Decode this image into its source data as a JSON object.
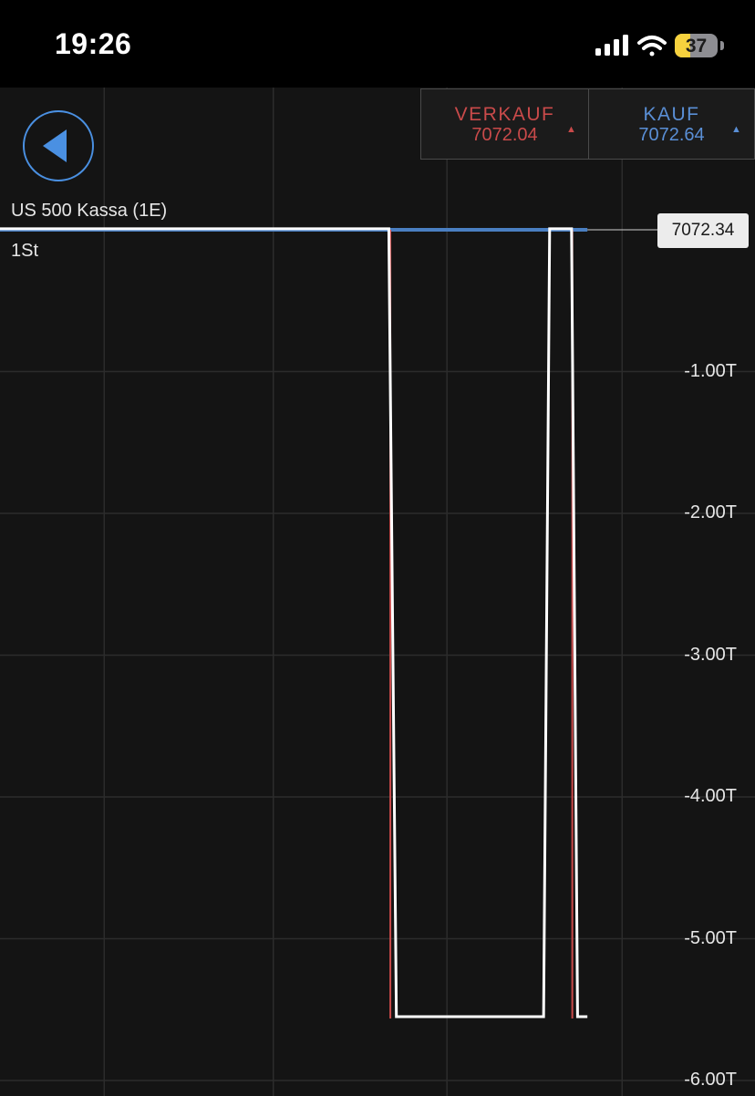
{
  "status_bar": {
    "time": "19:26",
    "battery_percent": "37",
    "battery_level": 0.37,
    "icons": [
      "signal-bars-icon",
      "wifi-icon",
      "battery-icon"
    ]
  },
  "header": {
    "back_icon": "back-arrow-icon",
    "instrument": "US 500 Kassa (1E)",
    "timeframe": "1St"
  },
  "quotes": {
    "sell_label": "VERKAUF",
    "sell_price": "7072.04",
    "sell_direction": "up",
    "buy_label": "KAUF",
    "buy_price": "7072.64",
    "buy_direction": "up"
  },
  "colors": {
    "background": "#141414",
    "sell": "#c94a4a",
    "buy": "#5a8fd6",
    "price_line": "#ffffff",
    "last_price_line": "#4a7fc1",
    "gridline": "#2c2c2c"
  },
  "chart_data": {
    "type": "line",
    "last_price": "7072.34",
    "y_ticks": [
      "-1.00T",
      "-2.00T",
      "-3.00T",
      "-4.00T",
      "-5.00T",
      "-6.00T"
    ],
    "y_tick_values": [
      -1000,
      -2000,
      -3000,
      -4000,
      -5000,
      -6000
    ],
    "ylim": [
      -6000,
      7.07234
    ],
    "series": [
      {
        "values": [
          7.07234,
          7.07234,
          -5550,
          -5550,
          7.07234,
          7.07234,
          -5550,
          -5550
        ],
        "x": [
          0,
          0.515,
          0.525,
          0.72,
          0.728,
          0.757,
          0.765,
          0.778
        ]
      }
    ],
    "sell_spikes_x": [
      0.517,
      0.758
    ],
    "grid": true
  }
}
